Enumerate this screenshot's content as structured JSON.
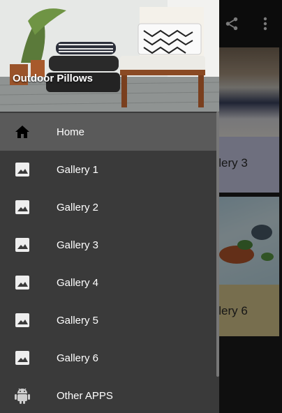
{
  "drawer": {
    "header_title": "Outdoor Pillows",
    "items": [
      {
        "label": "Home",
        "icon": "home-icon",
        "active": true
      },
      {
        "label": "Gallery 1",
        "icon": "image-icon",
        "active": false
      },
      {
        "label": "Gallery 2",
        "icon": "image-icon",
        "active": false
      },
      {
        "label": "Gallery 3",
        "icon": "image-icon",
        "active": false
      },
      {
        "label": "Gallery 4",
        "icon": "image-icon",
        "active": false
      },
      {
        "label": "Gallery 5",
        "icon": "image-icon",
        "active": false
      },
      {
        "label": "Gallery 6",
        "icon": "image-icon",
        "active": false
      },
      {
        "label": "Other APPS",
        "icon": "android-icon",
        "active": false
      }
    ]
  },
  "background": {
    "cards": [
      {
        "caption": "allery 3"
      },
      {
        "caption": "allery 6"
      }
    ],
    "actions": [
      "share-icon",
      "more-vert-icon"
    ]
  },
  "colors": {
    "drawer_bg": "#3a3a3a",
    "active_item_bg": "#5a5a5a",
    "text": "#ffffff"
  }
}
